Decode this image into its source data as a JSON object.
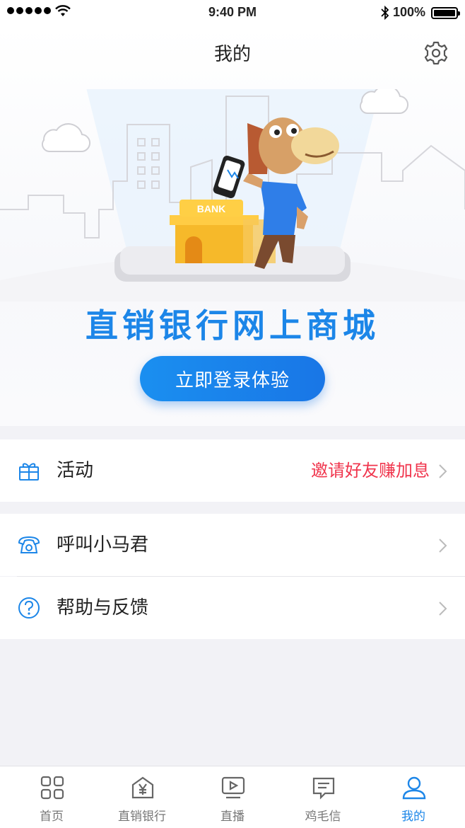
{
  "status_bar": {
    "time": "9:40 PM",
    "battery": "100%"
  },
  "header": {
    "title": "我的",
    "settings_icon": "gear-icon"
  },
  "hero": {
    "bank_sign": "BANK",
    "slogan": "直销银行网上商城",
    "login_button": "立即登录体验"
  },
  "menu": {
    "activity": {
      "label": "活动",
      "extra": "邀请好友赚加息",
      "icon": "gift-icon"
    },
    "call": {
      "label": "呼叫小马君",
      "icon": "telephone-icon"
    },
    "help": {
      "label": "帮助与反馈",
      "icon": "question-icon"
    }
  },
  "tabbar": {
    "items": [
      {
        "label": "首页",
        "icon": "grid-icon"
      },
      {
        "label": "直销银行",
        "icon": "bank-yen-icon"
      },
      {
        "label": "直播",
        "icon": "play-icon"
      },
      {
        "label": "鸡毛信",
        "icon": "message-icon"
      },
      {
        "label": "我的",
        "icon": "user-icon"
      }
    ],
    "active_index": 4
  },
  "colors": {
    "accent": "#1c86e8",
    "promo": "#f0354d",
    "background": "#f2f2f6"
  }
}
